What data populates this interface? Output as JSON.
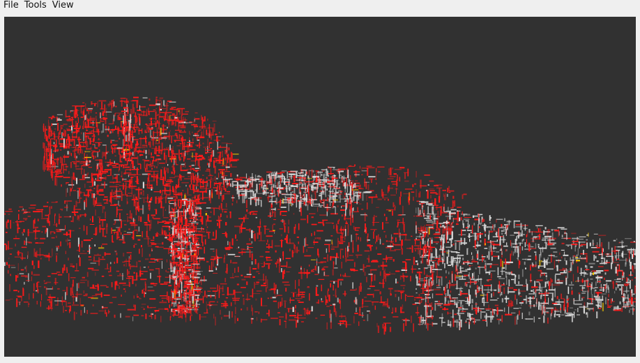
{
  "menubar": {
    "items": [
      {
        "label": "File"
      },
      {
        "label": "Tools"
      },
      {
        "label": "View"
      }
    ]
  },
  "viewport": {
    "background_color": "#313131",
    "point_colors": {
      "primary": "#ff1a1a",
      "secondary": "#d9d9d9",
      "accent": "#f2c400"
    }
  }
}
